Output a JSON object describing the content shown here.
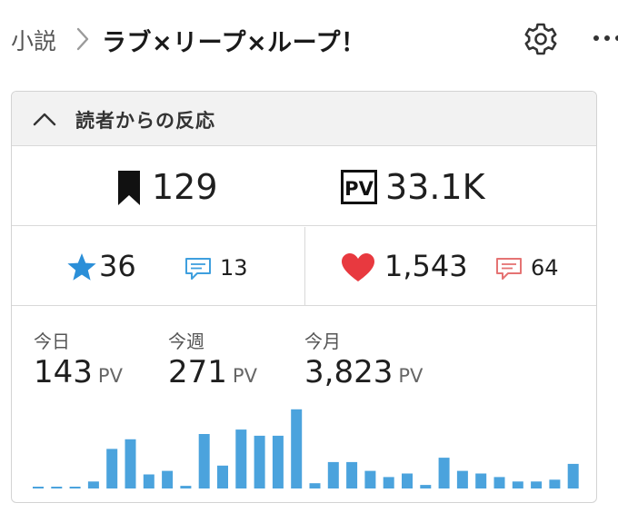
{
  "breadcrumb": {
    "root": "小説",
    "title": "ラブ×リープ×ループ！"
  },
  "card": {
    "title": "読者からの反応",
    "bookmarks": "129",
    "page_views": "33.1K",
    "stars": "36",
    "star_comments": "13",
    "likes": "1,543",
    "like_comments": "64"
  },
  "periods": [
    {
      "label": "今日",
      "value": "143",
      "unit": "PV"
    },
    {
      "label": "今週",
      "value": "271",
      "unit": "PV"
    },
    {
      "label": "今月",
      "value": "3,823",
      "unit": "PV"
    }
  ],
  "colors": {
    "accent_blue": "#3e9fde",
    "heart_red": "#e8393f",
    "comment_red": "#e57373"
  },
  "chart_data": {
    "type": "bar",
    "values": [
      2,
      2,
      2,
      8,
      45,
      56,
      16,
      20,
      3,
      62,
      26,
      67,
      60,
      60,
      90,
      6,
      30,
      30,
      20,
      13,
      17,
      4,
      35,
      20,
      17,
      13,
      8,
      8,
      10,
      28
    ],
    "color": "#4ba3dd",
    "ylim": [
      0,
      95
    ]
  }
}
